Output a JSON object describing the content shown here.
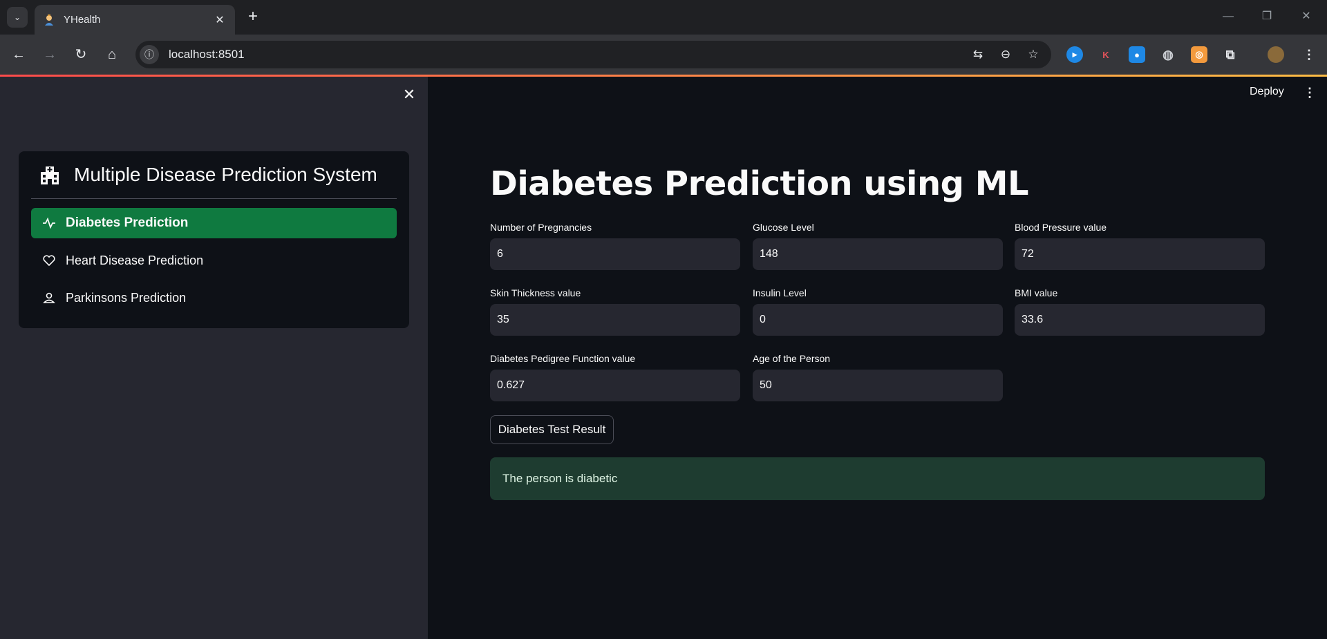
{
  "browser": {
    "tab_title": "YHealth",
    "url": "localhost:8501"
  },
  "sidebar": {
    "menu_title": "Multiple Disease Prediction System",
    "items": [
      {
        "label": "Diabetes Prediction",
        "icon": "activity-icon",
        "active": true
      },
      {
        "label": "Heart Disease Prediction",
        "icon": "heart-icon",
        "active": false
      },
      {
        "label": "Parkinsons Prediction",
        "icon": "person-icon",
        "active": false
      }
    ]
  },
  "header": {
    "deploy_label": "Deploy"
  },
  "main": {
    "title": "Diabetes Prediction using ML",
    "fields": [
      {
        "label": "Number of Pregnancies",
        "value": "6"
      },
      {
        "label": "Glucose Level",
        "value": "148"
      },
      {
        "label": "Blood Pressure value",
        "value": "72"
      },
      {
        "label": "Skin Thickness value",
        "value": "35"
      },
      {
        "label": "Insulin Level",
        "value": "0"
      },
      {
        "label": "BMI value",
        "value": "33.6"
      },
      {
        "label": "Diabetes Pedigree Function value",
        "value": "0.627"
      },
      {
        "label": "Age of the Person",
        "value": "50"
      }
    ],
    "button_label": "Diabetes Test Result",
    "result_text": "The person is diabetic"
  },
  "colors": {
    "accent_active": "#0f7a40",
    "result_bg": "#1e3c30"
  }
}
